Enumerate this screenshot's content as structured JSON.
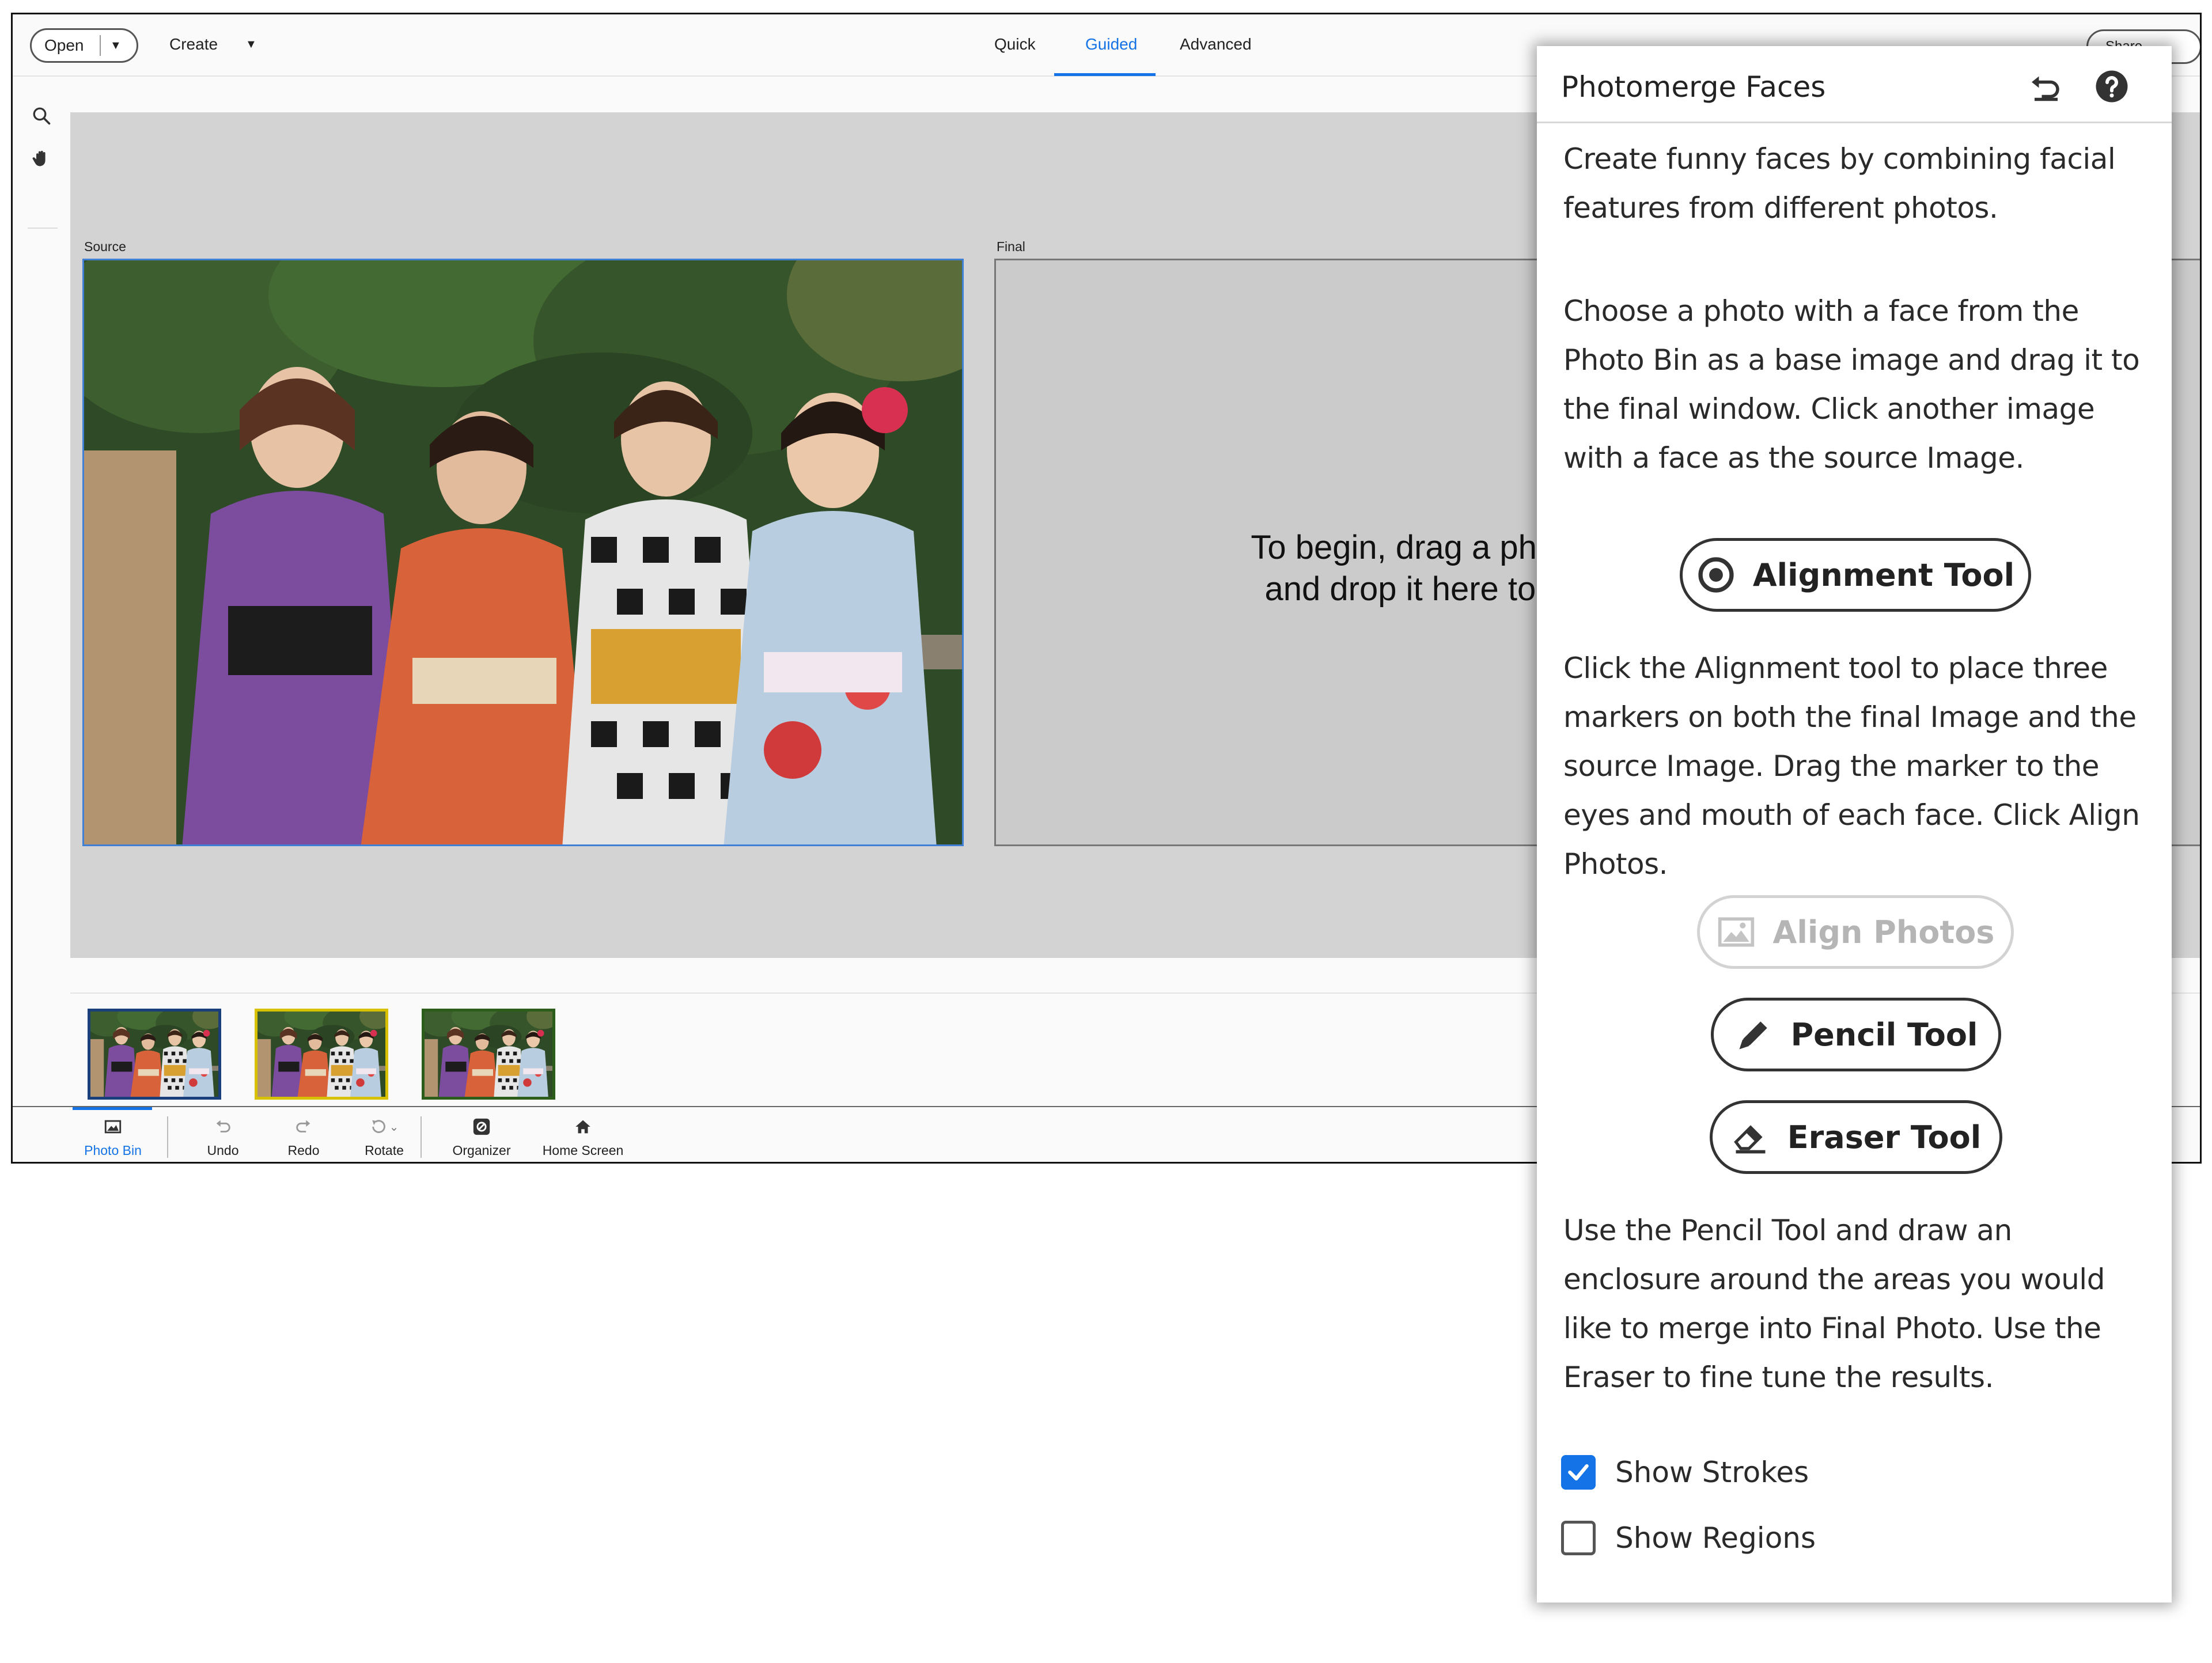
{
  "toolbar": {
    "open_label": "Open",
    "create_label": "Create",
    "modes": [
      "Quick",
      "Guided",
      "Advanced"
    ],
    "active_mode": "Guided",
    "share_label": "Share"
  },
  "canvas": {
    "source_label": "Source",
    "final_label": "Final",
    "final_hint_line1": "To begin, drag a photo from",
    "final_hint_line2": "and drop it here to set the"
  },
  "left_tools": [
    "zoom-icon",
    "hand-icon"
  ],
  "photo_bin": {
    "thumbnail_count": 3
  },
  "bottom_bar": [
    {
      "label": "Photo Bin",
      "icon": "photo-bin-icon",
      "active": true
    },
    {
      "label": "Undo",
      "icon": "undo-icon"
    },
    {
      "label": "Redo",
      "icon": "redo-icon"
    },
    {
      "label": "Rotate",
      "icon": "rotate-icon"
    },
    {
      "label": "Organizer",
      "icon": "organizer-icon"
    },
    {
      "label": "Home Screen",
      "icon": "home-icon"
    }
  ],
  "panel": {
    "title": "Photomerge Faces",
    "intro": "Create funny faces by combining facial features from different photos.",
    "step1": "Choose a photo with a face from the Photo Bin as a base image and drag it to the final window. Click another image with a face as the source Image.",
    "alignment_tool_label": "Alignment Tool",
    "step2": "Click the Alignment tool to place three markers on both the final Image and the source Image. Drag the marker to the eyes and mouth of each face. Click Align Photos.",
    "align_photos_label": "Align Photos",
    "pencil_tool_label": "Pencil Tool",
    "eraser_tool_label": "Eraser Tool",
    "step3": "Use the Pencil Tool and draw an enclosure around the areas you would like to merge into Final Photo. Use the Eraser to fine tune the results.",
    "show_strokes_label": "Show Strokes",
    "show_strokes_checked": true,
    "show_regions_label": "Show Regions",
    "show_regions_checked": false
  },
  "colors": {
    "accent": "#1473e6",
    "canvas_bg": "#d3d3d3",
    "disabled": "#b5b5b5"
  }
}
